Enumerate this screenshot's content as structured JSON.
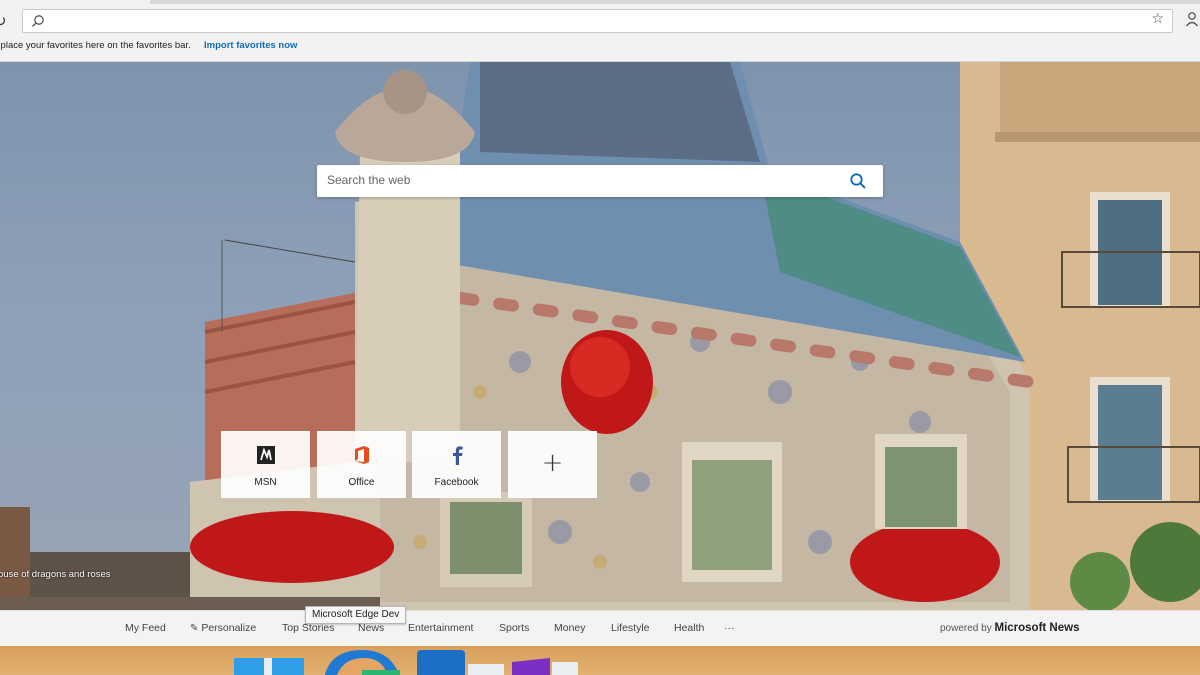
{
  "browser": {
    "address_value": "",
    "favorites_text": "o, place your favorites here on the favorites bar.",
    "favorites_link": "Import favorites now",
    "icons": [
      "refresh-icon",
      "search-icon",
      "favorite-star-icon",
      "profile-icon"
    ]
  },
  "search": {
    "placeholder": "Search the web"
  },
  "tiles": [
    {
      "label": "MSN",
      "icon": "msn-icon"
    },
    {
      "label": "Office",
      "icon": "office-icon",
      "color": "#e74c1c"
    },
    {
      "label": "Facebook",
      "icon": "facebook-icon",
      "color": "#3b5998"
    },
    {
      "label": "+",
      "icon": "add-icon"
    }
  ],
  "image_caption": "ouse of dragons and roses",
  "tooltip": "Microsoft Edge Dev",
  "news_nav": {
    "items": [
      "My Feed",
      "Personalize",
      "Top Stories",
      "News",
      "Entertainment",
      "Sports",
      "Money",
      "Lifestyle",
      "Health",
      "···"
    ],
    "powered_by_prefix": "powered by",
    "powered_by_brand": "Microsoft News"
  },
  "colors": {
    "accent": "#0f6cbd",
    "taskbar": "#dca462",
    "news_bar": "#f4f3f1"
  }
}
